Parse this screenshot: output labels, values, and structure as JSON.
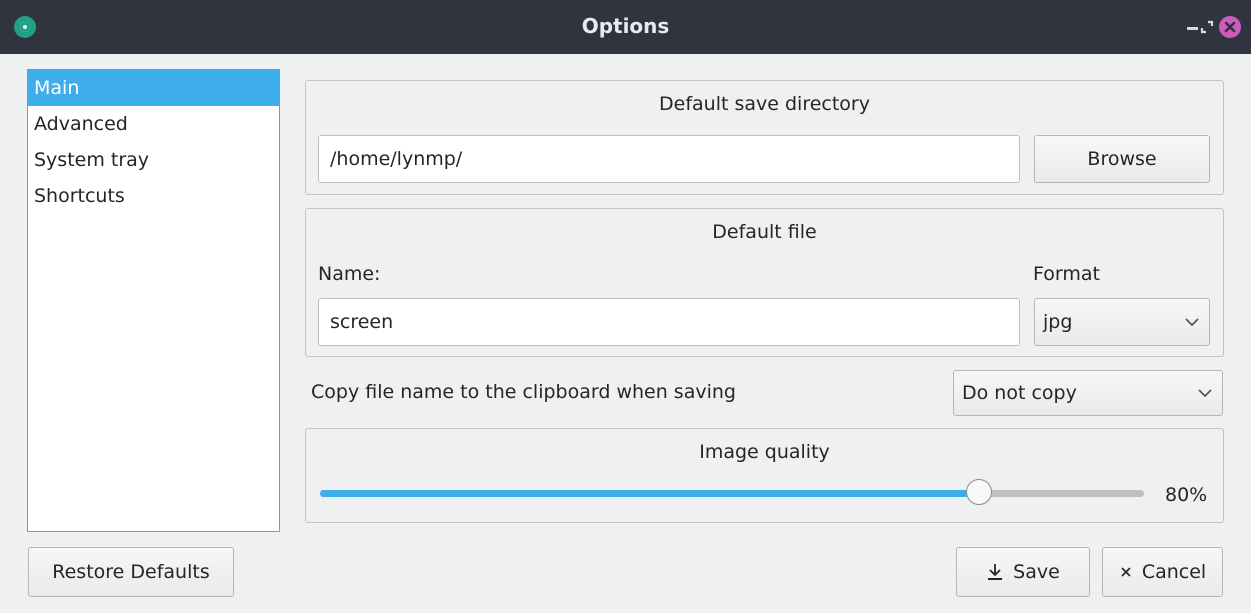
{
  "window": {
    "title": "Options"
  },
  "sidebar": {
    "items": [
      {
        "label": "Main",
        "selected": true
      },
      {
        "label": "Advanced"
      },
      {
        "label": "System tray"
      },
      {
        "label": "Shortcuts"
      }
    ]
  },
  "save_directory": {
    "title": "Default save directory",
    "path": "/home/lynmp/",
    "browse_label": "Browse"
  },
  "default_file": {
    "title": "Default file",
    "name_label": "Name:",
    "name_value": "screen",
    "format_label": "Format",
    "format_value": "jpg"
  },
  "clipboard": {
    "label": "Copy file name to the clipboard when saving",
    "value": "Do not copy"
  },
  "image_quality": {
    "title": "Image quality",
    "value": 0.8,
    "display": "80%"
  },
  "footer": {
    "restore_label": "Restore Defaults",
    "save_label": "Save",
    "cancel_label": "Cancel"
  },
  "colors": {
    "accent": "#3daee9",
    "titlebar": "#2f343f",
    "close": "#cc5bbf"
  },
  "icons": {
    "app": "screenshot-app-icon",
    "save": "download-icon",
    "cancel": "close-x-icon"
  }
}
